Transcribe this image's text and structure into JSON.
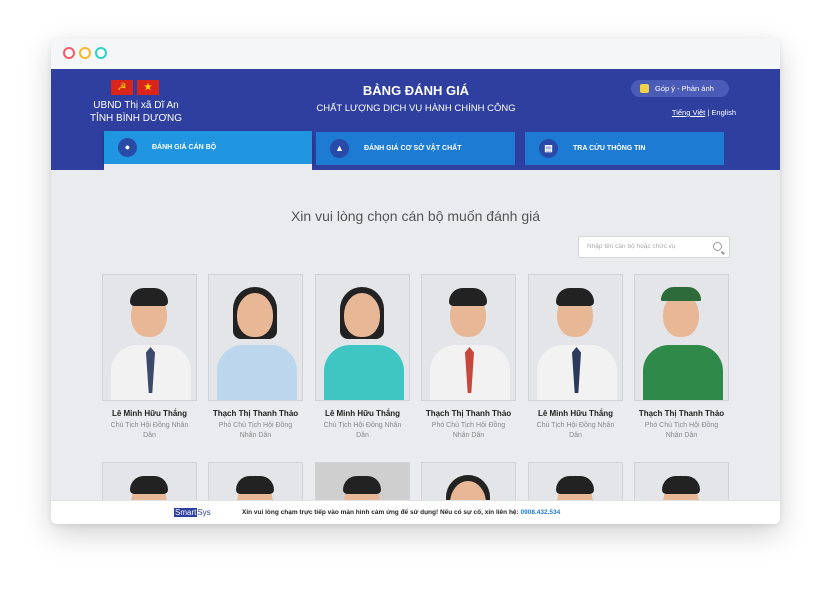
{
  "header": {
    "org_line1": "UBND Thị xã Dĩ An",
    "org_line2": "TỈNH BÌNH DƯƠNG",
    "title": "BẢNG ĐÁNH GIÁ",
    "subtitle": "CHẤT LƯỢNG DỊCH VỤ HÀNH CHÍNH CÔNG",
    "feedback_label": "Góp ý - Phản ánh",
    "lang_vi": "Tiếng Việt",
    "lang_sep": "|",
    "lang_en": "English"
  },
  "tabs": [
    {
      "label": "ĐÁNH GIÁ CÁN BỘ",
      "icon": "person-icon"
    },
    {
      "label": "ĐÁNH GIÁ CƠ SỞ VẬT CHẤT",
      "icon": "thumbs-up-icon"
    },
    {
      "label": "TRA CỨU THÔNG TIN",
      "icon": "document-icon"
    }
  ],
  "main": {
    "prompt": "Xin vui lòng chọn cán bộ muốn đánh giá",
    "search_placeholder": "Nhập tên cán bộ hoặc chức vụ"
  },
  "staff": [
    {
      "name": "Lê Minh Hữu Thắng",
      "role": "Chủ Tịch Hội Đồng Nhân Dân"
    },
    {
      "name": "Thạch Thị Thanh Thảo",
      "role": "Phó Chủ Tịch Hội Đồng Nhân Dân"
    },
    {
      "name": "Lê Minh Hữu Thắng",
      "role": "Chủ Tịch Hội Đồng Nhân Dân"
    },
    {
      "name": "Thạch Thị Thanh Thảo",
      "role": "Phó Chủ Tịch Hội Đồng Nhân Dân"
    },
    {
      "name": "Lê Minh Hữu Thắng",
      "role": "Chủ Tịch Hội Đồng Nhân Dân"
    },
    {
      "name": "Thạch Thị Thanh Thảo",
      "role": "Phó Chủ Tịch Hội Đồng Nhân Dân"
    }
  ],
  "footer": {
    "brand_part1": "Smart",
    "brand_part2": "Sys",
    "notice": "Xin vui lòng chạm trực tiếp vào màn hình cảm ứng để sử dụng! Nếu có sự cố, xin liên hệ: ",
    "phone": "0908.432.534"
  },
  "colors": {
    "header_bg": "#2e3fa0",
    "tab_bg": "#1d7bd4",
    "accent": "#2196e0"
  }
}
